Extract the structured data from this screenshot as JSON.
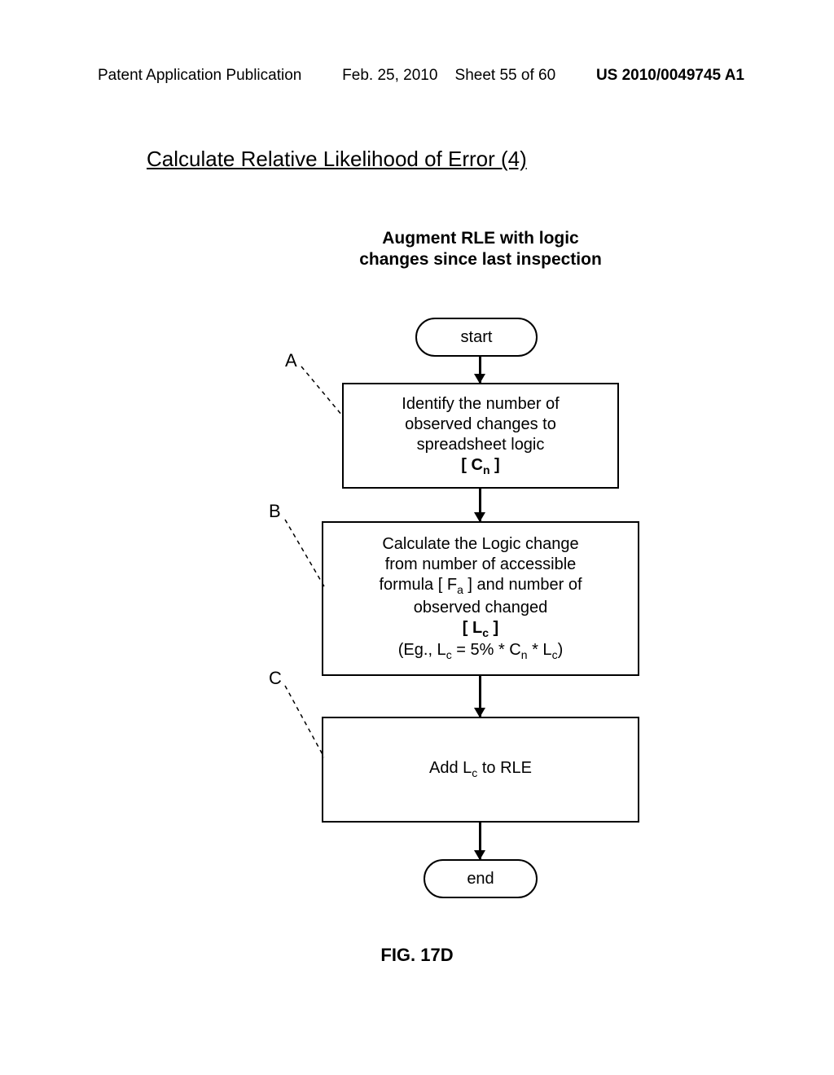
{
  "header": {
    "left": "Patent Application Publication",
    "date": "Feb. 25, 2010",
    "sheet": "Sheet 55 of 60",
    "right": "US 2010/0049745 A1"
  },
  "section_title": "Calculate Relative Likelihood of Error (4)",
  "subtitle": "Augment RLE with logic changes since last inspection",
  "terminator": {
    "start": "start",
    "end": "end"
  },
  "pointer": {
    "a": "A",
    "b": "B",
    "c": "C"
  },
  "figure_label": "FIG. 17D",
  "steps": {
    "a": {
      "line1": "Identify the number of",
      "line2": "observed changes to",
      "line3": "spreadsheet logic",
      "sym_open": "[ C",
      "sym_sub": "n",
      "sym_close": " ]"
    },
    "b": {
      "line1": "Calculate the Logic change",
      "line2": "from number of accessible",
      "l3a": "formula [ F",
      "l3a_sub": "a",
      "l3b": " ] and number of",
      "line4": "observed changed",
      "sym_open": "[ L",
      "sym_sub": "c",
      "sym_close": " ]",
      "eg_a": "(Eg., L",
      "eg_sub1": "c",
      "eg_b": " = 5% * C",
      "eg_sub2": "n",
      "eg_c": " * L",
      "eg_sub3": "c",
      "eg_d": ")"
    },
    "c": {
      "t1": "Add L",
      "tsub": "c",
      "t2": " to RLE"
    }
  }
}
